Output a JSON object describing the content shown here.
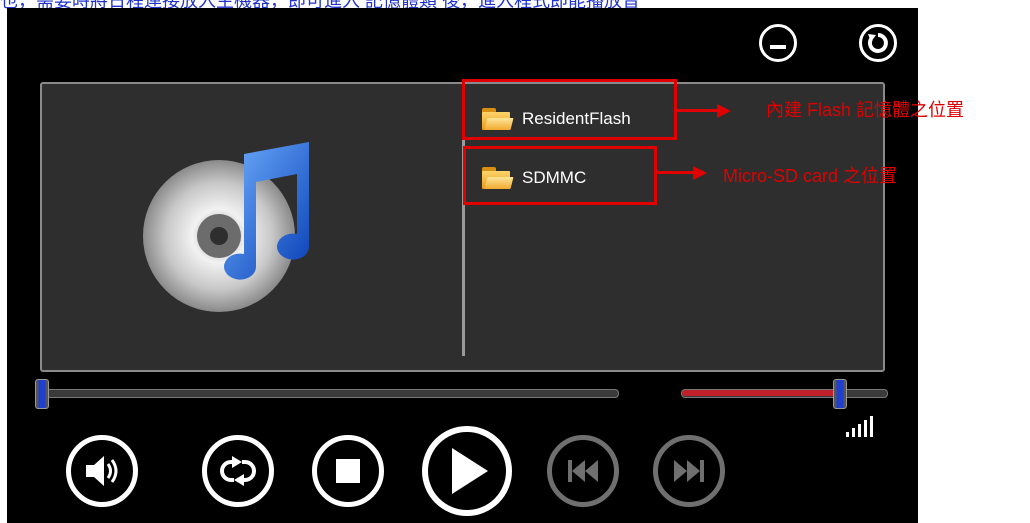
{
  "doc_text": "也，需要時將日程連接放入主機器，即可進入        記憶體類                  後，進入程式即能播放音",
  "colors": {
    "annotation": "#e00000",
    "volume_fill": "#c0202a",
    "thumb": "#1f3fd0"
  },
  "window_buttons": {
    "minimize_icon": "minus-icon",
    "refresh_icon": "refresh-icon"
  },
  "album_art": {
    "icon": "itunes-music-cd-icon"
  },
  "folders": [
    {
      "label": "ResidentFlash",
      "icon": "folder-icon"
    },
    {
      "label": "SDMMC",
      "icon": "folder-icon"
    }
  ],
  "annotations": [
    {
      "text": "內建 Flash 記憶體之位置"
    },
    {
      "text": "Micro-SD card 之位置"
    }
  ],
  "progress": {
    "fraction": 0.0
  },
  "volume": {
    "fraction": 0.8
  },
  "controls": {
    "volume_icon": "speaker-icon",
    "repeat_icon": "repeat-icon",
    "stop_icon": "stop-icon",
    "play_icon": "play-icon",
    "prev_icon": "previous-track-icon",
    "next_icon": "next-track-icon",
    "signal_icon": "signal-bars-icon"
  }
}
